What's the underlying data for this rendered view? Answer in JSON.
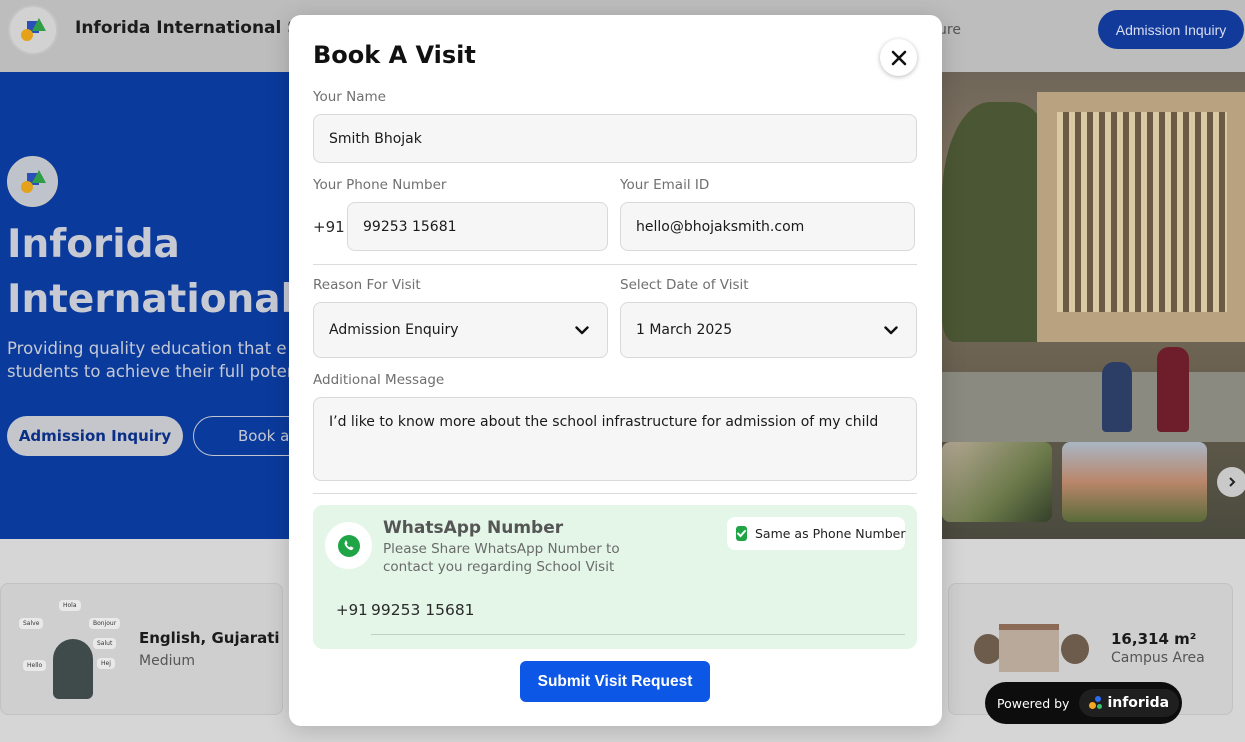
{
  "app": {
    "brand": "Inforida International Sch",
    "nav_partial": "ure",
    "admission_cta": "Admission Inquiry"
  },
  "hero": {
    "title_line1": "Inforida",
    "title_line2": "International S",
    "subtitle_line1": "Providing quality education that e",
    "subtitle_line2": "students to achieve their full poter",
    "primary_button": "Admission Inquiry",
    "secondary_button": "Book a"
  },
  "cards": {
    "language": {
      "title": "English, Gujarati",
      "subtitle": "Medium",
      "bubbles": [
        "Hola",
        "Salve",
        "Salut",
        "Hello",
        "Bonjour",
        "Hej"
      ]
    },
    "campus": {
      "value": "16,314 m²",
      "label": "Campus Area"
    }
  },
  "powered": {
    "label": "Powered by",
    "brand": "inforida"
  },
  "modal": {
    "title": "Book A Visit",
    "name_label": "Your Name",
    "name_value": "Smith Bhojak",
    "phone_label": "Your Phone Number",
    "phone_prefix": "+91",
    "phone_value": "99253 15681",
    "email_label": "Your Email ID",
    "email_value": "hello@bhojaksmith.com",
    "reason_label": "Reason For Visit",
    "reason_value": "Admission Enquiry",
    "date_label": "Select Date of Visit",
    "date_value": "1 March 2025",
    "message_label": "Additional Message",
    "message_value": "I’d like to know more about the school infrastructure for admission of my child",
    "whatsapp": {
      "title": "WhatsApp Number",
      "description": "Please Share WhatsApp Number to contact you regarding School Visit",
      "same_as_phone_label": "Same as Phone Number",
      "same_as_phone_checked": true,
      "prefix": "+91",
      "number": "99253 15681"
    },
    "submit_label": "Submit Visit Request"
  },
  "colors": {
    "primary": "#0d57e6",
    "hero_blue": "#0a3a9c",
    "whatsapp_green": "#1fa546",
    "whatsapp_bg": "#e3f6e8"
  }
}
